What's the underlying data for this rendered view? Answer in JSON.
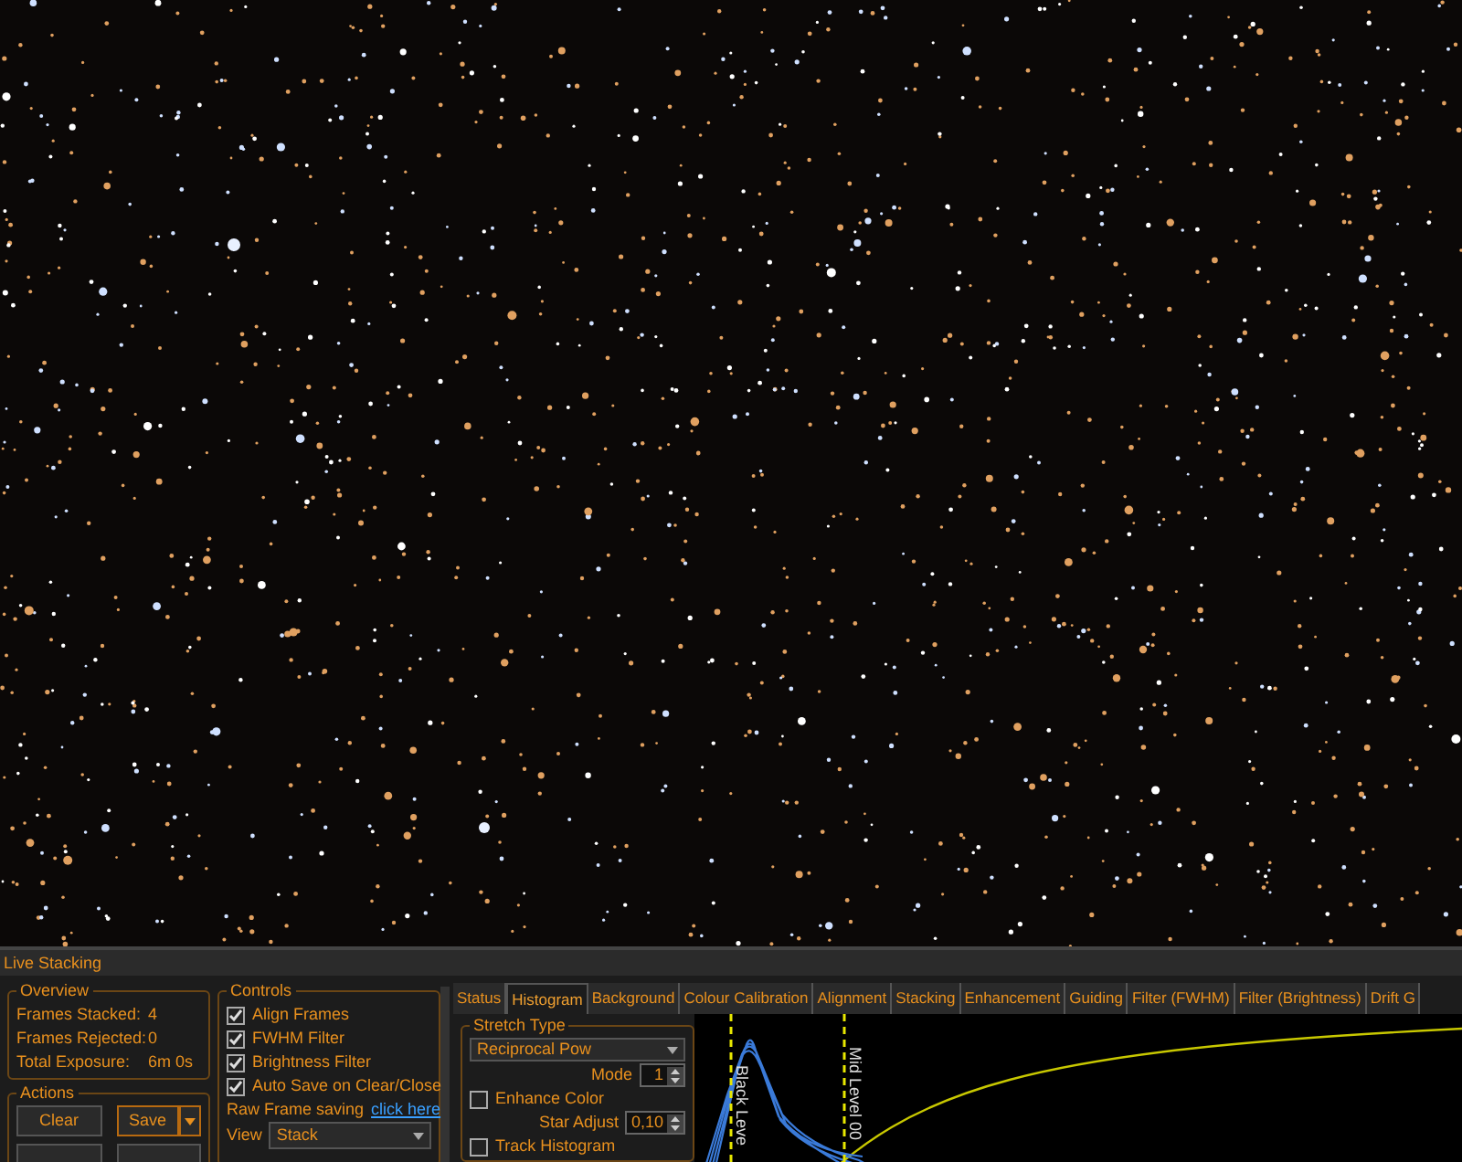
{
  "panel": {
    "title": "Live Stacking"
  },
  "overview": {
    "title": "Overview",
    "rows": [
      {
        "label": "Frames Stacked:",
        "value": "4"
      },
      {
        "label": "Frames Rejected:",
        "value": "0"
      },
      {
        "label": "Total Exposure:",
        "value": "6m 0s"
      }
    ]
  },
  "actions": {
    "title": "Actions",
    "buttons": [
      {
        "label": "Clear",
        "kind": "plain"
      },
      {
        "label": "Save",
        "kind": "split"
      }
    ]
  },
  "controls": {
    "title": "Controls",
    "checkboxes": [
      {
        "label": "Align Frames",
        "checked": true
      },
      {
        "label": "FWHM Filter",
        "checked": true
      },
      {
        "label": "Brightness Filter",
        "checked": true
      },
      {
        "label": "Auto Save on Clear/Close",
        "checked": true
      }
    ],
    "raw_saving": {
      "label": "Raw Frame saving",
      "link": "click here"
    },
    "view": {
      "label": "View",
      "value": "Stack"
    }
  },
  "tabs": [
    {
      "label": "Status",
      "selected": false
    },
    {
      "label": "Histogram",
      "selected": true
    },
    {
      "label": "Background",
      "selected": false
    },
    {
      "label": "Colour Calibration",
      "selected": false
    },
    {
      "label": "Alignment",
      "selected": false
    },
    {
      "label": "Stacking",
      "selected": false
    },
    {
      "label": "Enhancement",
      "selected": false
    },
    {
      "label": "Guiding",
      "selected": false
    },
    {
      "label": "Filter (FWHM)",
      "selected": false
    },
    {
      "label": "Filter (Brightness)",
      "selected": false
    },
    {
      "label": "Drift G",
      "selected": false
    }
  ],
  "stretch": {
    "title": "Stretch Type",
    "select": "Reciprocal Pow",
    "mode": {
      "label": "Mode",
      "value": "1"
    },
    "enhance_color": {
      "label": "Enhance Color",
      "checked": false
    },
    "star_adjust": {
      "label": "Star Adjust",
      "value": "0,10"
    },
    "track_histogram": {
      "label": "Track Histogram",
      "checked": false
    }
  },
  "histogram": {
    "black_level_label": "Black Leve",
    "mid_level_label": "Mid Level 00"
  }
}
